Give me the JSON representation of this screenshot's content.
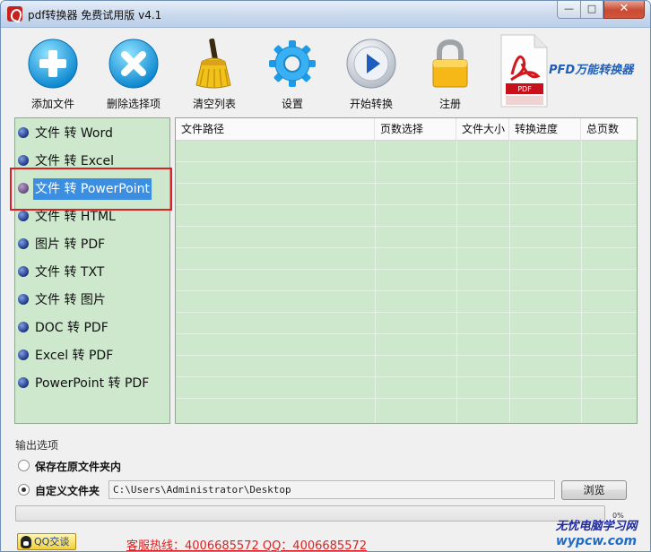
{
  "window": {
    "title": "pdf转换器 免费试用版 v4.1",
    "controls": {
      "minimize": "—",
      "maximize": "□",
      "close": "✕"
    }
  },
  "toolbar": {
    "buttons": [
      {
        "label": "添加文件",
        "icon": "add-icon"
      },
      {
        "label": "删除选择项",
        "icon": "delete-icon"
      },
      {
        "label": "清空列表",
        "icon": "broom-icon"
      },
      {
        "label": "设置",
        "icon": "gear-icon"
      },
      {
        "label": "开始转换",
        "icon": "play-icon"
      },
      {
        "label": "注册",
        "icon": "lock-icon"
      }
    ],
    "logo": {
      "text": "PFD万能转换器",
      "badge_text": "PDF"
    }
  },
  "conversion_options": {
    "selected_index": 2,
    "items": [
      "文件 转 Word",
      "文件 转 Excel",
      "文件 转 PowerPoint",
      "文件 转 HTML",
      "图片 转 PDF",
      "文件 转 TXT",
      "文件 转 图片",
      "DOC 转 PDF",
      "Excel 转 PDF",
      "PowerPoint 转 PDF"
    ]
  },
  "file_table": {
    "columns": [
      "文件路径",
      "页数选择",
      "文件大小",
      "转换进度",
      "总页数"
    ],
    "rows": []
  },
  "output": {
    "section_title": "输出选项",
    "option_original": "保存在原文件夹内",
    "option_custom": "自定义文件夹",
    "selected": "custom",
    "custom_path": "C:\\Users\\Administrator\\Desktop",
    "browse_label": "浏览"
  },
  "progress": {
    "percent_text": "0%",
    "fraction": 0.0
  },
  "footer": {
    "qq_button": "QQ交谈",
    "hotline": "客服热线：4006685572 QQ：4006685572"
  },
  "watermark": {
    "line1": "无忧电脑学习网",
    "line2": "wypcw.com"
  },
  "colors": {
    "panel_green": "#cde8cd",
    "highlight_red": "#e01f24",
    "accent_blue": "#1f5fb5"
  }
}
